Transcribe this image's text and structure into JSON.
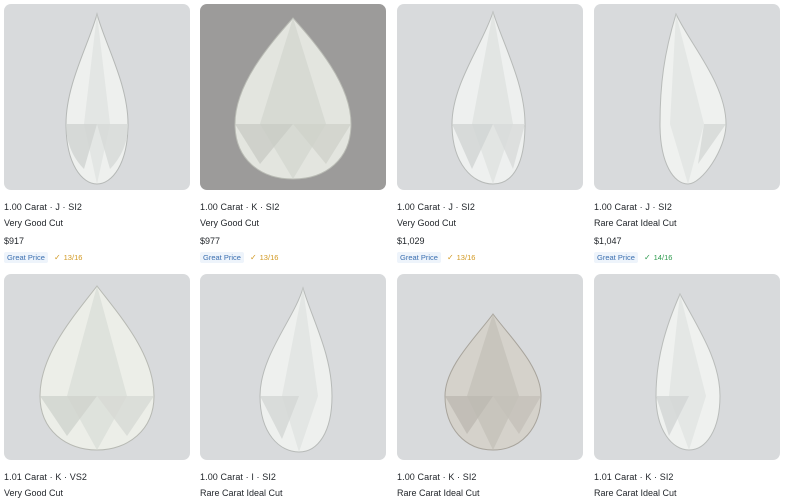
{
  "colors": {
    "badge_text": "#3b6fb0",
    "score_warn": "#d29922",
    "score_good": "#2e9b4e"
  },
  "listings": [
    {
      "title": "1.00 Carat · J · SI2",
      "cut": "Very Good Cut",
      "price": "$917",
      "badge": "Great Price",
      "check_icon": "checkmark-icon",
      "score": "13/16",
      "score_status": "warn"
    },
    {
      "title": "1.00 Carat · K · SI2",
      "cut": "Very Good Cut",
      "price": "$977",
      "badge": "Great Price",
      "check_icon": "checkmark-icon",
      "score": "13/16",
      "score_status": "warn"
    },
    {
      "title": "1.00 Carat · J · SI2",
      "cut": "Very Good Cut",
      "price": "$1,029",
      "badge": "Great Price",
      "check_icon": "checkmark-icon",
      "score": "13/16",
      "score_status": "warn"
    },
    {
      "title": "1.00 Carat · J · SI2",
      "cut": "Rare Carat Ideal Cut",
      "price": "$1,047",
      "badge": "Great Price",
      "check_icon": "checkmark-icon",
      "score": "14/16",
      "score_status": "good"
    },
    {
      "title": "1.01 Carat · K · VS2",
      "cut": "Very Good Cut"
    },
    {
      "title": "1.00 Carat · I · SI2",
      "cut": "Rare Carat Ideal Cut"
    },
    {
      "title": "1.00 Carat · K · SI2",
      "cut": "Rare Carat Ideal Cut"
    },
    {
      "title": "1.01 Carat · K · SI2",
      "cut": "Rare Carat Ideal Cut"
    }
  ]
}
